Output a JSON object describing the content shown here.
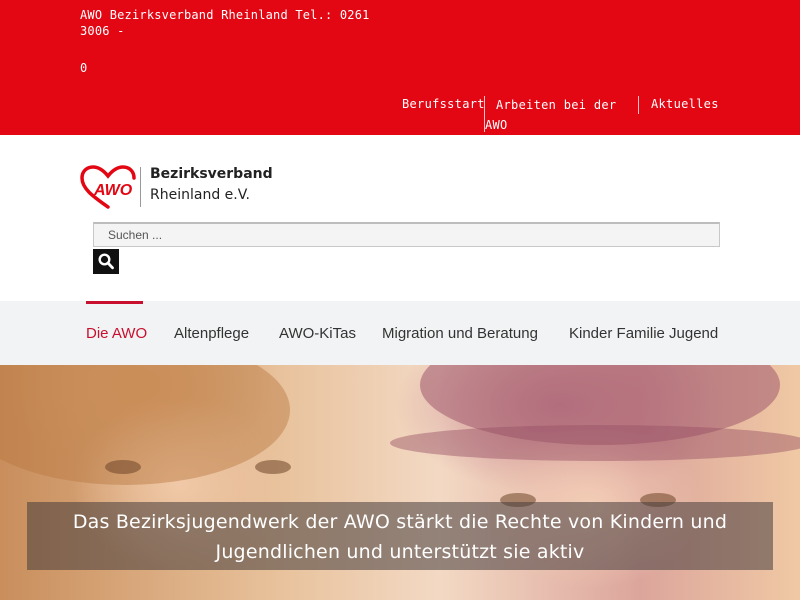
{
  "topbar": {
    "contact_text": "AWO Bezirksverband Rheinland Tel.: 0261 3006 -",
    "contact_suffix": "0",
    "nav": [
      {
        "label": "Berufsstart"
      },
      {
        "label": "Arbeiten bei der AWO"
      },
      {
        "label": "Aktuelles"
      }
    ]
  },
  "logo": {
    "mark_text": "AWO",
    "line1": "Bezirksverband",
    "line2": "Rheinland e.V."
  },
  "search": {
    "placeholder": "Suchen ...",
    "icon": "search-icon"
  },
  "mainnav": {
    "items": [
      {
        "label": "Die AWO",
        "active": true
      },
      {
        "label": "Altenpflege",
        "active": false
      },
      {
        "label": "AWO-KiTas",
        "active": false
      },
      {
        "label": "Migration und Beratung",
        "active": false
      },
      {
        "label": "Kinder Familie Jugend",
        "active": false
      }
    ]
  },
  "hero": {
    "caption": "Das Bezirksjugendwerk der AWO stärkt die Rechte von Kindern und Jugendlichen und unterstützt sie aktiv"
  },
  "colors": {
    "brand_red": "#e30613",
    "active_nav": "#c8102e",
    "nav_background": "#f2f3f4"
  }
}
